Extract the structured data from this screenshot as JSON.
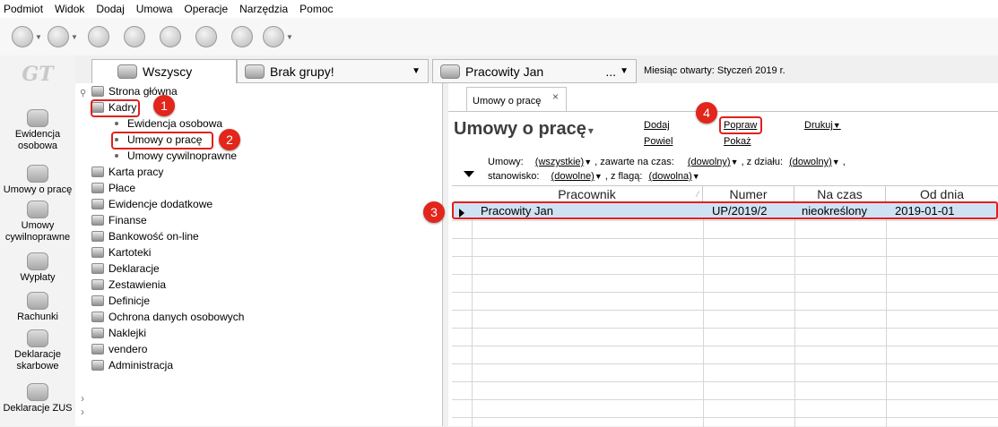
{
  "menu": [
    "Podmiot",
    "Widok",
    "Dodaj",
    "Umowa",
    "Operacje",
    "Narzędzia",
    "Pomoc"
  ],
  "toolbar": {
    "icons": [
      "back-icon",
      "forward-icon",
      "employee-icon",
      "eraser-icon",
      "brush-icon",
      "people-icon",
      "printer-icon",
      "help-icon"
    ]
  },
  "sidebar": {
    "logo": "GT",
    "items": [
      {
        "label": "Ewidencja osobowa",
        "icon": "person-icon"
      },
      {
        "label": "Umowy o pracę",
        "icon": "contract-icon"
      },
      {
        "label": "Umowy cywilnoprawne",
        "icon": "civil-contract-icon"
      },
      {
        "label": "Wypłaty",
        "icon": "payout-icon"
      },
      {
        "label": "Rachunki",
        "icon": "bill-icon"
      },
      {
        "label": "Deklaracje skarbowe",
        "icon": "declaration-icon"
      },
      {
        "label": "Deklaracje ZUS",
        "icon": "zus-icon"
      }
    ]
  },
  "tabs": {
    "group_all": "Wszyscy",
    "group_none": "Brak grupy!",
    "employee": "Pracowity Jan",
    "employee_more": "...",
    "month": "Miesiąc otwarty: Styczeń 2019 r."
  },
  "tree": {
    "items": [
      {
        "label": "Strona główna"
      },
      {
        "label": "Kadry"
      },
      {
        "label": "Karta pracy"
      },
      {
        "label": "Płace"
      },
      {
        "label": "Ewidencje dodatkowe"
      },
      {
        "label": "Finanse"
      },
      {
        "label": "Bankowość on-line"
      },
      {
        "label": "Kartoteki"
      },
      {
        "label": "Deklaracje"
      },
      {
        "label": "Zestawienia"
      },
      {
        "label": "Definicje"
      },
      {
        "label": "Ochrona danych osobowych"
      },
      {
        "label": "Naklejki"
      },
      {
        "label": "vendero"
      },
      {
        "label": "Administracja"
      }
    ],
    "sub": [
      "Ewidencja osobowa",
      "Umowy o pracę",
      "Umowy cywilnoprawne"
    ]
  },
  "badges": [
    "1",
    "2",
    "3",
    "4"
  ],
  "content": {
    "tab_label": "Umowy o pracę",
    "tab_close": "×",
    "title": "Umowy o pracę",
    "links": {
      "dodaj": "Dodaj",
      "powiel": "Powiel",
      "popraw": "Popraw",
      "pokaz": "Pokaż",
      "drukuj": "Drukuj"
    },
    "filters": {
      "umowy_label": "Umowy:",
      "umowy_value": "(wszystkie)",
      "czas_label": ", zawarte na czas:",
      "czas_value": "(dowolny)",
      "dzial_label": ", z działu:",
      "dzial_value": "(dowolny)",
      "stanowisko_label": "stanowisko:",
      "stanowisko_value": "(dowolne)",
      "flaga_label": ", z flagą:",
      "flaga_value": "(dowolna)"
    },
    "table": {
      "headers": [
        "Pracownik",
        "Numer",
        "Na czas",
        "Od dnia"
      ],
      "rows": [
        [
          "Pracowity Jan",
          "UP/2019/2",
          "nieokreślony",
          "2019-01-01"
        ]
      ]
    }
  },
  "colors": {
    "highlight_red": "#e0201e",
    "row_selected": "#cfe2f3"
  }
}
